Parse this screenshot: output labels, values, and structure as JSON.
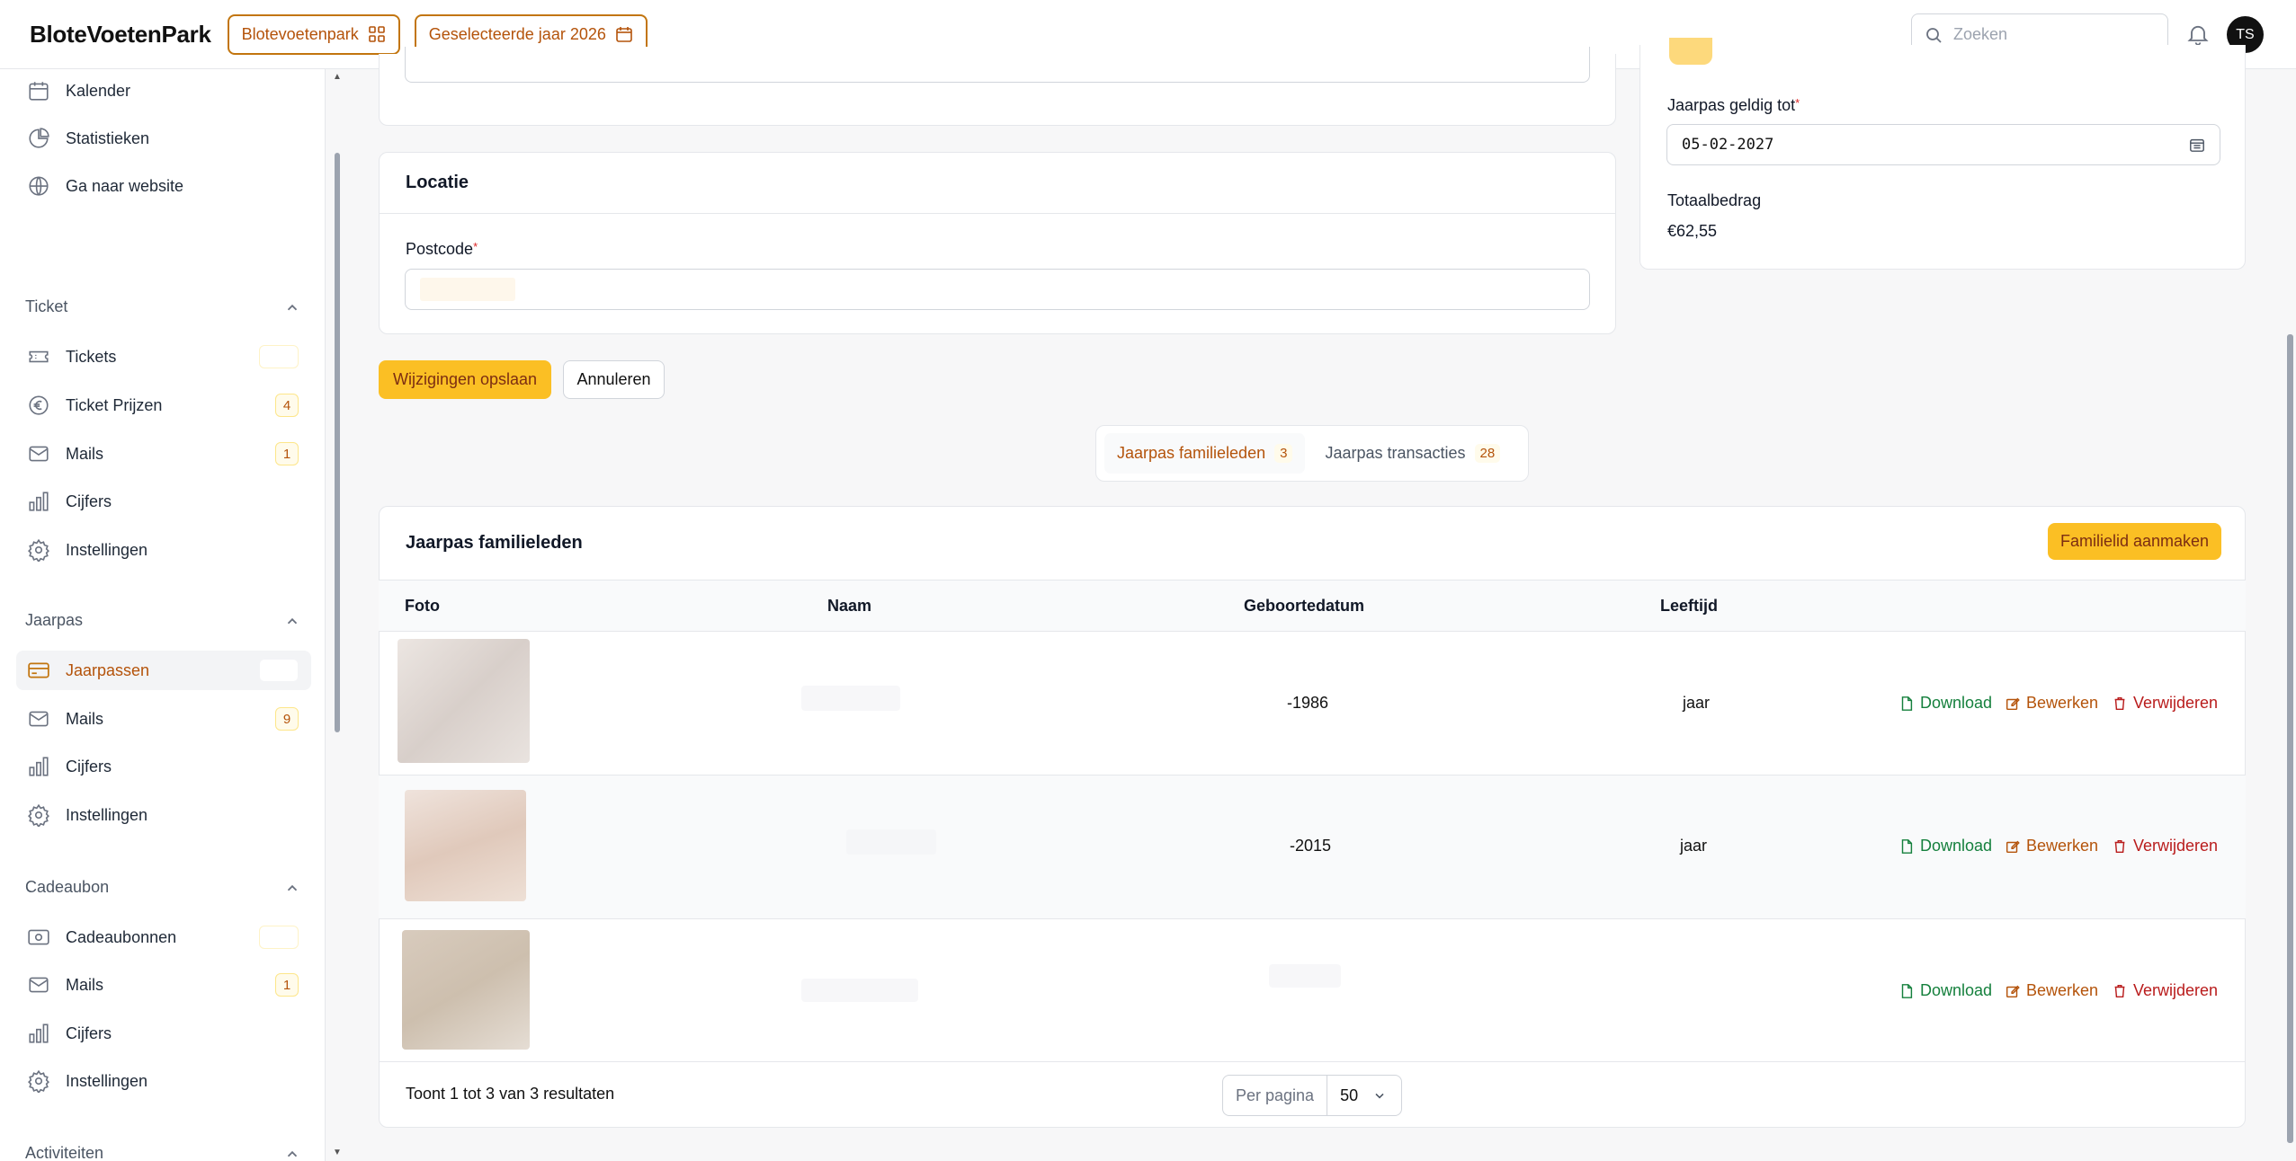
{
  "header": {
    "brand": "BloteVoetenPark",
    "park_pill": "Blotevoetenpark",
    "year_pill": "Geselecteerde jaar 2026",
    "search_placeholder": "Zoeken",
    "avatar_initials": "TS"
  },
  "sidebar": {
    "top_items": [
      {
        "label": "Kalender",
        "icon": "calendar-icon"
      },
      {
        "label": "Statistieken",
        "icon": "pie-chart-icon"
      },
      {
        "label": "Ga naar website",
        "icon": "globe-icon"
      }
    ],
    "sections": [
      {
        "title": "Ticket",
        "items": [
          {
            "label": "Tickets",
            "icon": "ticket-icon",
            "badge": ""
          },
          {
            "label": "Ticket Prijzen",
            "icon": "euro-icon",
            "badge": "4"
          },
          {
            "label": "Mails",
            "icon": "mail-icon",
            "badge": "1"
          },
          {
            "label": "Cijfers",
            "icon": "bar-chart-icon"
          },
          {
            "label": "Instellingen",
            "icon": "settings-icon"
          }
        ]
      },
      {
        "title": "Jaarpas",
        "items": [
          {
            "label": "Jaarpassen",
            "icon": "card-icon",
            "badge": "",
            "active": true
          },
          {
            "label": "Mails",
            "icon": "mail-icon",
            "badge": "9"
          },
          {
            "label": "Cijfers",
            "icon": "bar-chart-icon"
          },
          {
            "label": "Instellingen",
            "icon": "settings-icon"
          }
        ]
      },
      {
        "title": "Cadeaubon",
        "items": [
          {
            "label": "Cadeaubonnen",
            "icon": "gift-card-icon",
            "badge": ""
          },
          {
            "label": "Mails",
            "icon": "mail-icon",
            "badge": "1"
          },
          {
            "label": "Cijfers",
            "icon": "bar-chart-icon"
          },
          {
            "label": "Instellingen",
            "icon": "settings-icon"
          }
        ]
      },
      {
        "title": "Activiteiten",
        "items": []
      }
    ]
  },
  "form": {
    "location_title": "Locatie",
    "postcode_label": "Postcode",
    "save_label": "Wijzigingen opslaan",
    "cancel_label": "Annuleren"
  },
  "side_panel": {
    "valid_until_label": "Jaarpas geldig tot",
    "valid_until_value": "05-02-2027",
    "total_label": "Totaalbedrag",
    "total_value": "€62,55"
  },
  "tabs": [
    {
      "label": "Jaarpas familieleden",
      "count": "3",
      "active": true
    },
    {
      "label": "Jaarpas transacties",
      "count": "28",
      "active": false
    }
  ],
  "members": {
    "title": "Jaarpas familieleden",
    "create_label": "Familielid aanmaken",
    "columns": [
      "Foto",
      "Naam",
      "Geboortedatum",
      "Leeftijd"
    ],
    "rows": [
      {
        "birthdate": "-1986",
        "age": "jaar"
      },
      {
        "birthdate": "-2015",
        "age": "jaar"
      },
      {
        "birthdate": "",
        "age": ""
      }
    ],
    "actions": {
      "download": "Download",
      "edit": "Bewerken",
      "delete": "Verwijderen"
    },
    "footer_text": "Toont 1 tot 3 van 3 resultaten",
    "per_page_label": "Per pagina",
    "per_page_value": "50"
  },
  "colors": {
    "accent": "#fbbf24",
    "accent_text": "#b4530a",
    "download": "#15803d",
    "delete": "#b91c1c"
  }
}
